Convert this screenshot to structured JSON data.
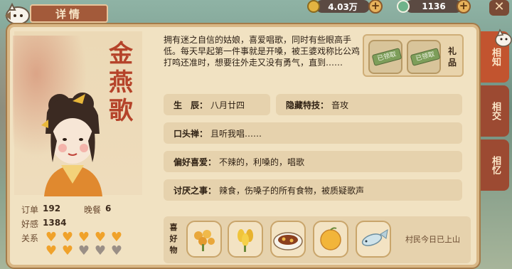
{
  "header": {
    "title": "详情"
  },
  "resources": [
    {
      "name": "coin",
      "value": "4.03万",
      "icon": "coin-icon"
    },
    {
      "name": "jade",
      "value": "1136",
      "icon": "jade-icon"
    }
  ],
  "character": {
    "name": "金燕歌",
    "description": "拥有迷之自信的姑娘，喜爱唱歌，同时有些眼高手低。每天早起第一件事就是开嗓，被王婆戏称比公鸡打鸣还准时，想要往外走又没有勇气，直到……",
    "stats": {
      "order_label": "订单",
      "order_value": "192",
      "dinner_label": "晚餐",
      "dinner_value": "6",
      "favor_label": "好感",
      "favor_value": "1384",
      "relation_label": "关系"
    },
    "relation_hearts": {
      "filled": 7,
      "total": 10
    }
  },
  "gifts": {
    "label": "礼品",
    "items": [
      {
        "status": "已领取"
      },
      {
        "status": "已领取"
      }
    ]
  },
  "info_rows": {
    "birth_label": "生　辰：",
    "birth_value": "八月廿四",
    "skill_label": "隐藏特技：",
    "skill_value": "音攻",
    "catchphrase_label": "口头禅：",
    "catchphrase_value": "且听我唱……",
    "likes_label": "偏好喜爱：",
    "likes_value": "不辣的，利嗓的，唱歌",
    "dislikes_label": "讨厌之事：",
    "dislikes_value": "辣食，伤嗓子的所有食物，被质疑歌声"
  },
  "side_tabs": [
    {
      "label": "相知",
      "active": true
    },
    {
      "label": "相交",
      "active": false
    },
    {
      "label": "相忆",
      "active": false
    }
  ],
  "favorite_food": {
    "label": "喜好物",
    "items": [
      "osmanthus-flower",
      "golden-grain",
      "braised-dish",
      "citrus-fruit",
      "silver-fish"
    ],
    "status": "村民今日已上山"
  },
  "colors": {
    "accent": "#a35a3a",
    "panel": "#f1e2c2",
    "row": "#e6d2ad",
    "name": "#b5432a"
  }
}
